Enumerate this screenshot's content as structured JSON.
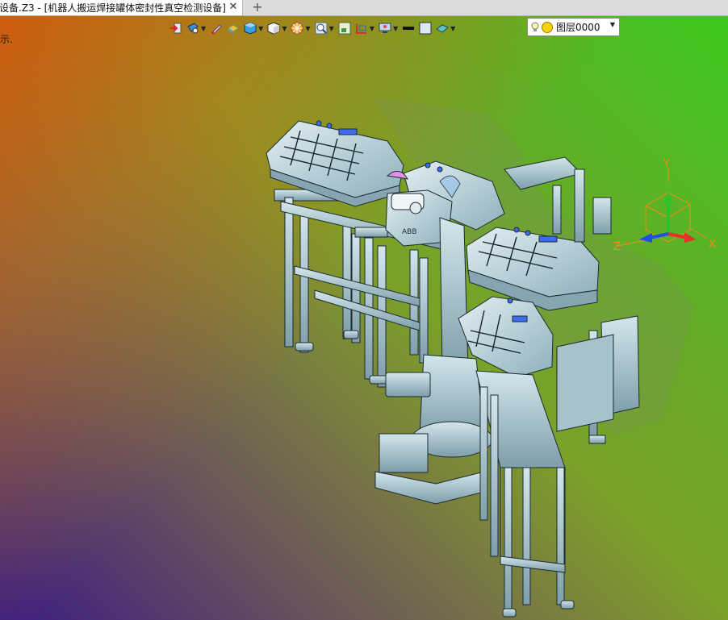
{
  "tab": {
    "title": "设备.Z3 - [机器人搬运焊接罐体密封性真空检测设备]",
    "close_glyph": "✕",
    "add_glyph": "+"
  },
  "viewport": {
    "hint_text": "示."
  },
  "toolbar": {
    "items": [
      {
        "name": "insert-icon",
        "dropdown": false
      },
      {
        "name": "view-render-icon",
        "dropdown": true
      },
      {
        "name": "pen-icon",
        "dropdown": false
      },
      {
        "name": "shade-icon",
        "dropdown": false
      },
      {
        "name": "cube-blue-icon",
        "dropdown": true
      },
      {
        "name": "cube-white-icon",
        "dropdown": true
      },
      {
        "name": "wheel-icon",
        "dropdown": true
      },
      {
        "name": "zoom-view-icon",
        "dropdown": true
      },
      {
        "name": "fit-icon",
        "dropdown": false
      },
      {
        "name": "section-icon",
        "dropdown": true
      },
      {
        "name": "display-icon",
        "dropdown": true
      },
      {
        "name": "line-color-icon",
        "dropdown": false
      },
      {
        "name": "face-color-icon",
        "dropdown": false
      },
      {
        "name": "surface-icon",
        "dropdown": true
      }
    ],
    "layer": {
      "label": "图层0000"
    }
  },
  "triad": {
    "x_label": "X",
    "y_label": "Y",
    "z_label": "Z"
  },
  "colors": {
    "accent_red": "#e8302a",
    "accent_green": "#2fc22f",
    "accent_blue": "#1e50e6",
    "axis_orange": "#f08c1e",
    "model_steel": "#b9d1d9"
  }
}
